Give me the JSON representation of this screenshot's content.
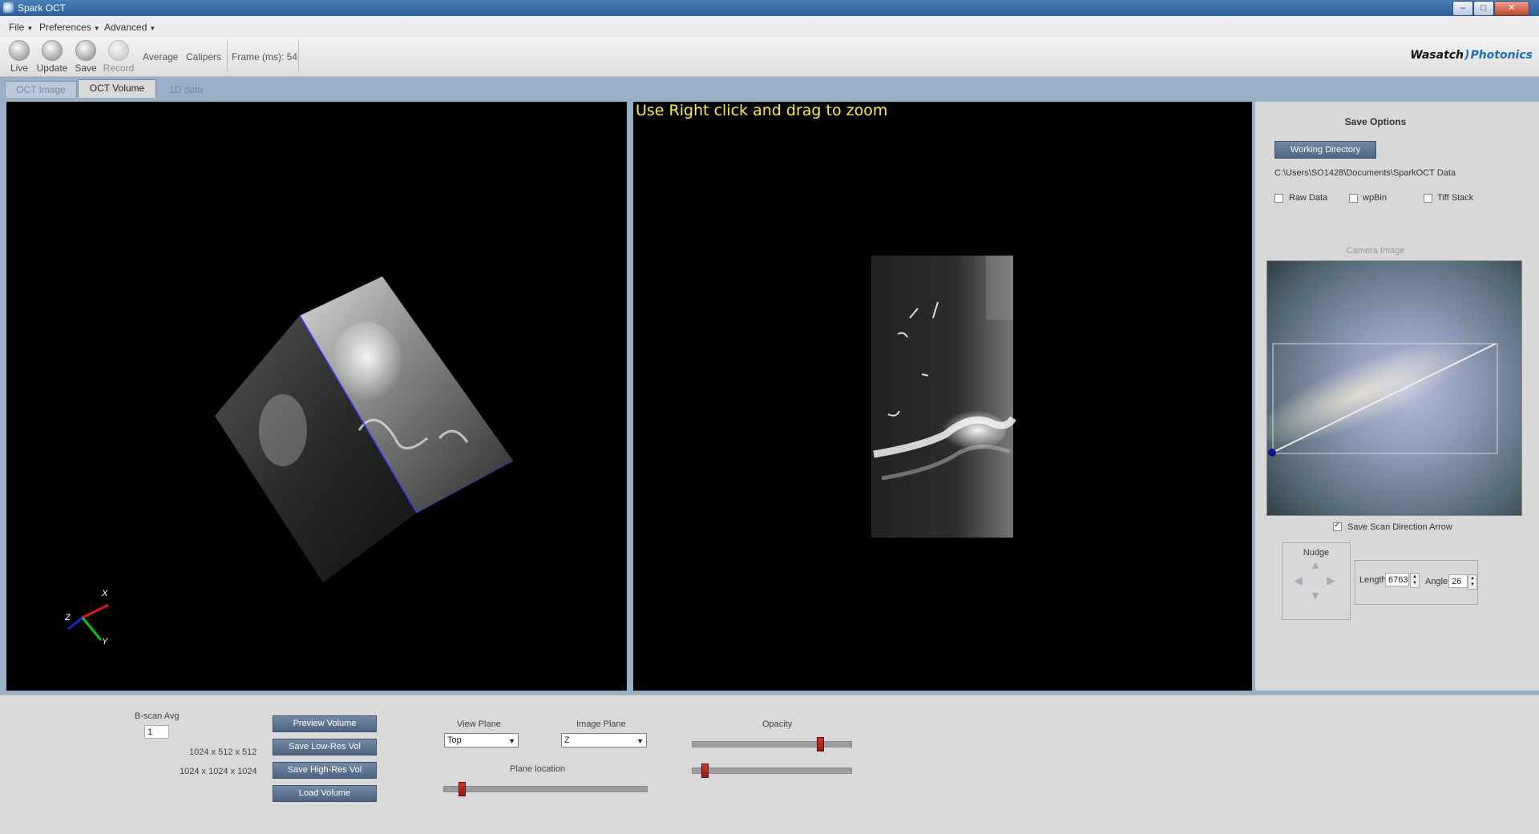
{
  "window": {
    "title": "Spark OCT",
    "min": "‒",
    "max": "□",
    "close": "✕"
  },
  "menu": [
    {
      "label": "File"
    },
    {
      "label": "Preferences"
    },
    {
      "label": "Advanced"
    }
  ],
  "toolbar": {
    "live": "Live",
    "update": "Update",
    "save": "Save",
    "record": "Record",
    "average": "Average",
    "calipers": "Calipers",
    "frame": "Frame (ms): 54",
    "logo_a": "Wasatch",
    "logo_b": "Photonics"
  },
  "tabs": [
    {
      "label": "OCT Image",
      "active": false
    },
    {
      "label": "OCT Volume",
      "active": true
    },
    {
      "label": "1D data",
      "active": false
    }
  ],
  "view2d": {
    "hint": "Use Right click and drag to zoom"
  },
  "axes": {
    "x": "X",
    "y": "Y",
    "z": "Z"
  },
  "save_options": {
    "title": "Save Options",
    "working_dir_button": "Working Directory",
    "path": "C:\\Users\\SO1428\\Documents\\SparkOCT Data",
    "raw": "Raw Data",
    "wpbin": "wpBin",
    "tiff": "Tiff Stack",
    "camera_title": "Camera Image",
    "save_arrow": "Save Scan Direction Arrow",
    "save_arrow_checked": true
  },
  "nudge": {
    "title": "Nudge",
    "length_label": "Length",
    "length": "6763",
    "angle_label": "Angle",
    "angle": "26"
  },
  "bottom": {
    "bscan_label": "B-scan Avg",
    "bscan_value": "1",
    "res_low": "1024 x 512 x 512",
    "res_high": "1024 x 1024 x 1024",
    "preview": "Preview Volume",
    "save_low": "Save Low-Res Vol",
    "save_high": "Save High-Res Vol",
    "load": "Load Volume",
    "view_plane_label": "View Plane",
    "view_plane": "Top",
    "image_plane_label": "Image Plane",
    "image_plane": "Z",
    "plane_location_label": "Plane location",
    "plane_location": 0.09,
    "opacity_label": "Opacity",
    "opacity": 0.81,
    "opacity2": 0.08
  },
  "colors": {
    "accent": "#1c6fb7",
    "hint": "#ffef3a",
    "slider_thumb": "#b02a20"
  }
}
